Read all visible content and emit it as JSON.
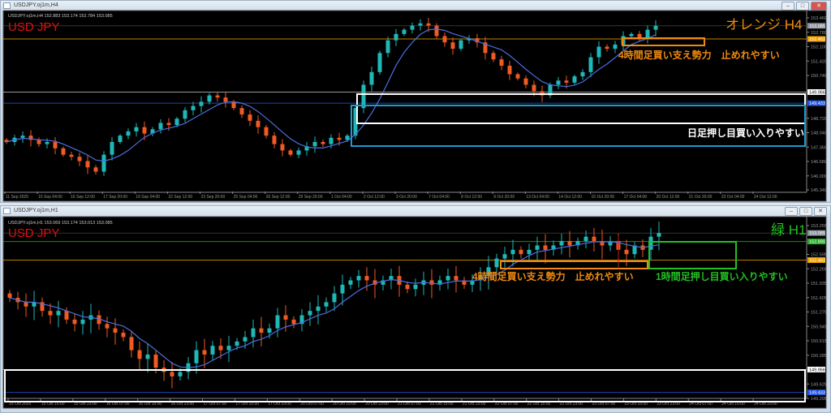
{
  "windows": [
    {
      "title": "USDJPY.oj1m,H4",
      "info": "USDJPY.oj1m,H4  152.883 153.174 152.784 153.085",
      "symbol": "USD JPY",
      "tag": "オレンジ H4",
      "notes": [
        "4時間足買い支え勢力　止めれやすい",
        "日足押し目買い入りやすい"
      ]
    },
    {
      "title": "USDJPY.oj1m,H1",
      "info": "USDJPY.oj1m,H1  153.069 153.174 153.013 153.085",
      "symbol": "USD JPY",
      "tag": "緑 H1",
      "notes": [
        "4時間足買い支え勢力　止めれやすい",
        "1時間足押し目買い入りやすい"
      ]
    }
  ],
  "buttons": {
    "min": "–",
    "max": "□",
    "close": "✕"
  },
  "colors": {
    "up": "#1fb8b8",
    "down": "#f05a23",
    "ma": "#4a6fe0",
    "orange": "#f08a10",
    "green": "#22c022",
    "blue": "#1a9ad6",
    "symbol": "#e01010"
  },
  "chart_data": [
    {
      "type": "candlestick",
      "title": "USDJPY.oj1m,H4",
      "ylim": [
        145.34,
        153.46
      ],
      "yticks": [
        "153.460",
        "152.780",
        "152.100",
        "151.420",
        "150.740",
        "148.720",
        "148.040",
        "147.360",
        "146.680",
        "146.000",
        "145.340"
      ],
      "price_tags": [
        {
          "label": "153.085",
          "value": 153.085,
          "color": "#8a8f99"
        },
        {
          "label": "152.463",
          "value": 152.463,
          "color": "#f0a000"
        },
        {
          "label": "149.956",
          "value": 149.956,
          "color": "#ffffff"
        },
        {
          "label": "149.433",
          "value": 149.433,
          "color": "#2255dd"
        }
      ],
      "xticks": [
        "11 Sep 2025",
        "15 Sep 04:00",
        "16 Sep 12:00",
        "17 Sep 20:00",
        "19 Sep 04:00",
        "22 Sep 12:00",
        "23 Sep 20:00",
        "25 Sep 04:00",
        "26 Sep 12:00",
        "29 Sep 20:00",
        "1 Oct 04:00",
        "2 Oct 12:00",
        "3 Oct 20:00",
        "7 Oct 04:00",
        "8 Oct 12:00",
        "9 Oct 20:00",
        "13 Oct 04:00",
        "14 Oct 12:00",
        "15 Oct 20:00",
        "17 Oct 04:00",
        "20 Oct 12:00",
        "21 Oct 20:00",
        "23 Oct 04:00",
        "24 Oct 12:00"
      ],
      "closes": [
        147.6,
        147.8,
        147.9,
        147.7,
        147.5,
        147.6,
        147.3,
        147.0,
        146.9,
        146.7,
        146.4,
        146.2,
        147.0,
        147.6,
        147.9,
        148.1,
        148.3,
        148.0,
        148.2,
        148.5,
        148.4,
        148.7,
        149.1,
        149.3,
        149.5,
        149.8,
        149.7,
        149.5,
        149.2,
        148.9,
        148.6,
        148.3,
        147.9,
        147.5,
        147.2,
        147.0,
        147.2,
        147.4,
        147.6,
        147.5,
        147.8,
        147.7,
        147.9,
        149.2,
        150.3,
        150.9,
        151.8,
        152.4,
        152.7,
        152.9,
        153.1,
        153.2,
        153.1,
        152.6,
        152.3,
        152.0,
        152.4,
        152.5,
        152.3,
        151.8,
        151.5,
        151.2,
        150.8,
        150.6,
        150.3,
        150.0,
        149.8,
        150.3,
        150.5,
        150.4,
        150.7,
        150.9,
        151.6,
        152.1,
        152.0,
        152.2,
        152.6,
        152.7,
        152.5,
        152.9,
        153.085
      ]
    },
    {
      "type": "candlestick",
      "title": "USDJPY.oj1m,H1",
      "ylim": [
        149.295,
        153.255
      ],
      "yticks": [
        "153.255",
        "152.595",
        "152.265",
        "151.935",
        "151.605",
        "151.275",
        "150.945",
        "150.615",
        "150.285",
        "149.625",
        "149.295"
      ],
      "price_tags": [
        {
          "label": "153.085",
          "value": 153.085,
          "color": "#8a8f99"
        },
        {
          "label": "152.890",
          "value": 152.89,
          "color": "#22b022"
        },
        {
          "label": "152.463",
          "value": 152.463,
          "color": "#f0a000"
        },
        {
          "label": "149.956",
          "value": 149.956,
          "color": "#ffffff"
        },
        {
          "label": "149.433",
          "value": 149.433,
          "color": "#2255dd"
        }
      ],
      "xticks": [
        "15 Oct 2025",
        "15 Oct 15:00",
        "15 Oct 23:00",
        "16 Oct 07:00",
        "16 Oct 15:00",
        "16 Oct 23:00",
        "17 Oct 07:00",
        "17 Oct 15:00",
        "17 Oct 23:00",
        "20 Oct 07:00",
        "20 Oct 15:00",
        "20 Oct 23:00",
        "21 Oct 07:00",
        "21 Oct 15:00",
        "21 Oct 23:00",
        "22 Oct 07:00",
        "22 Oct 15:00",
        "22 Oct 23:00",
        "23 Oct 07:00",
        "23 Oct 15:00",
        "23 Oct 23:00",
        "24 Oct 07:00",
        "24 Oct 15:00",
        "24 Oct 23:00"
      ],
      "closes": [
        151.6,
        151.5,
        151.4,
        151.5,
        151.3,
        151.2,
        151.3,
        151.1,
        151.0,
        151.1,
        151.2,
        151.0,
        150.9,
        150.8,
        150.7,
        150.4,
        150.2,
        150.3,
        150.0,
        149.9,
        149.8,
        149.9,
        150.1,
        150.4,
        150.3,
        150.5,
        150.4,
        150.5,
        150.6,
        150.7,
        150.9,
        150.8,
        150.9,
        151.2,
        151.1,
        151.0,
        151.2,
        151.3,
        151.4,
        151.5,
        151.7,
        151.9,
        152.0,
        152.1,
        152.0,
        151.9,
        152.0,
        152.1,
        151.9,
        151.8,
        151.9,
        152.0,
        151.9,
        152.0,
        152.1,
        152.0,
        151.9,
        152.0,
        152.1,
        152.3,
        152.5,
        152.6,
        152.7,
        152.6,
        152.7,
        152.8,
        152.7,
        152.8,
        152.9,
        152.8,
        152.9,
        153.0,
        152.9,
        152.8,
        152.9,
        152.7,
        152.6,
        152.8,
        152.7,
        153.0,
        153.085
      ]
    }
  ]
}
